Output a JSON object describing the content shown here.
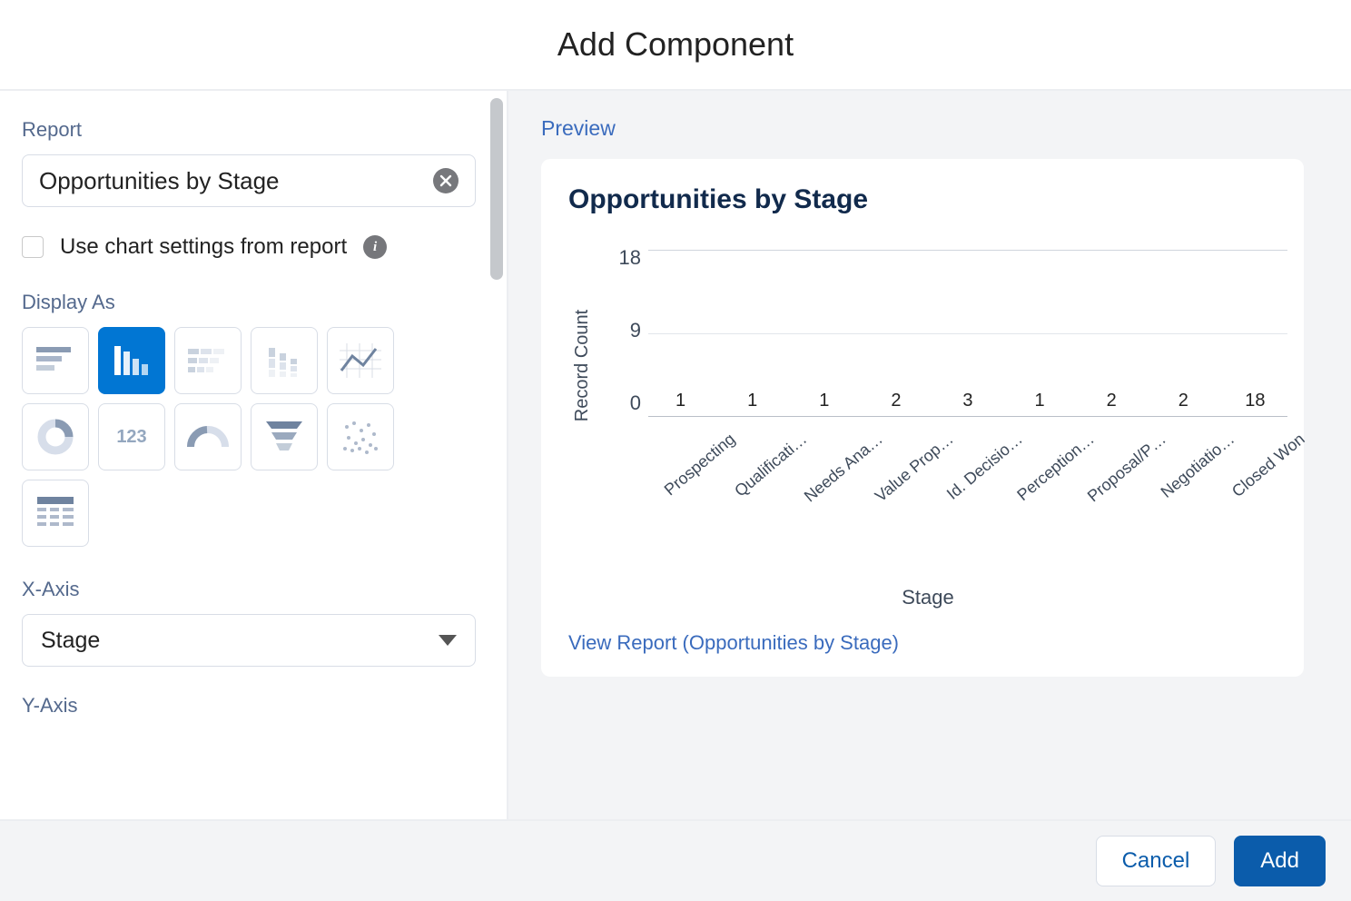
{
  "modal": {
    "title": "Add Component"
  },
  "left": {
    "report_label": "Report",
    "report_value": "Opportunities by Stage",
    "use_settings_label": "Use chart settings from report",
    "display_as_label": "Display As",
    "xaxis_label": "X-Axis",
    "xaxis_value": "Stage",
    "yaxis_label": "Y-Axis"
  },
  "preview": {
    "label": "Preview",
    "chart_title": "Opportunities by Stage",
    "view_report_link": "View Report (Opportunities by Stage)"
  },
  "footer": {
    "cancel": "Cancel",
    "add": "Add"
  },
  "chart_data": {
    "type": "bar",
    "title": "Opportunities by Stage",
    "xlabel": "Stage",
    "ylabel": "Record Count",
    "ylim": [
      0,
      18
    ],
    "yticks": [
      0,
      9,
      18
    ],
    "categories": [
      "Prospecting",
      "Qualificati…",
      "Needs Ana…",
      "Value Prop…",
      "Id. Decisio…",
      "Perception…",
      "Proposal/P…",
      "Negotiatio…",
      "Closed Won"
    ],
    "values": [
      1,
      1,
      1,
      2,
      3,
      1,
      2,
      2,
      18
    ]
  }
}
